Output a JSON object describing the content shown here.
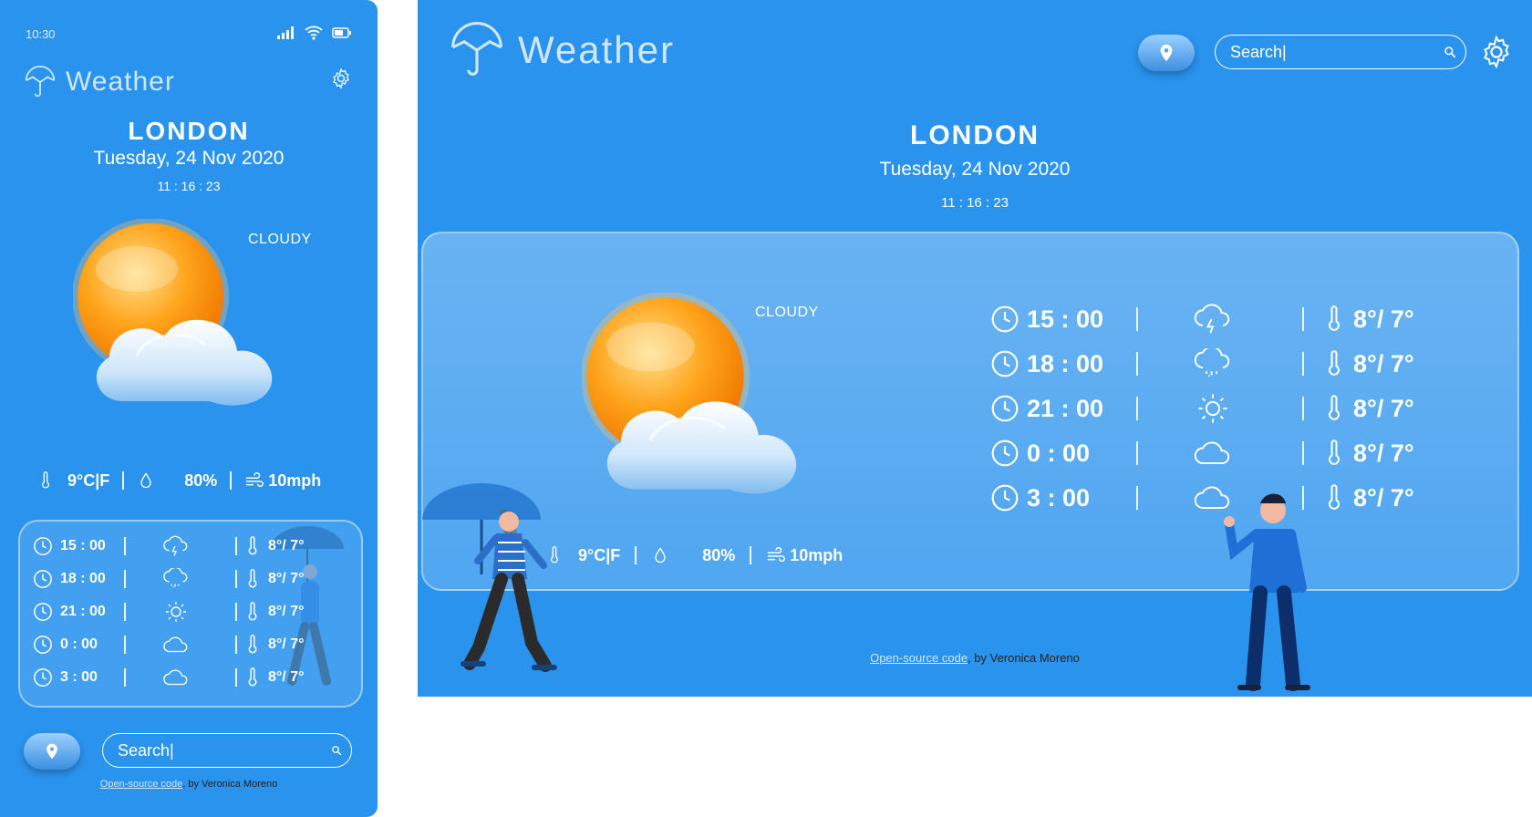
{
  "mobile": {
    "status_time": "10:30",
    "app_title": "Weather",
    "city": "LONDON",
    "date": "Tuesday, 24 Nov 2020",
    "clock": "11 : 16 : 23",
    "condition": "CLOUDY",
    "stats": {
      "temp": "9°C|F",
      "humidity": "80%",
      "wind": "10mph"
    },
    "forecast": [
      {
        "time": "15 : 00",
        "icon": "thunder-cloud-icon",
        "temps": "8°/ 7°"
      },
      {
        "time": "18 : 00",
        "icon": "rain-cloud-icon",
        "temps": "8°/ 7°"
      },
      {
        "time": "21 : 00",
        "icon": "sun-icon",
        "temps": "8°/ 7°"
      },
      {
        "time": "0 : 00",
        "icon": "cloud-icon",
        "temps": "8°/ 7°"
      },
      {
        "time": "3 : 00",
        "icon": "cloud-icon",
        "temps": "8°/ 7°"
      }
    ],
    "search_placeholder": "Search|",
    "footer": {
      "link": "Open-source code",
      "text": ", by Veronica Moreno"
    }
  },
  "desktop": {
    "app_title": "Weather",
    "city": "LONDON",
    "date": "Tuesday, 24 Nov 2020",
    "clock": "11 : 16 : 23",
    "condition": "CLOUDY",
    "stats": {
      "temp": "9°C|F",
      "humidity": "80%",
      "wind": "10mph"
    },
    "forecast": [
      {
        "time": "15 : 00",
        "icon": "thunder-cloud-icon",
        "temps": "8°/ 7°"
      },
      {
        "time": "18 : 00",
        "icon": "rain-cloud-icon",
        "temps": "8°/ 7°"
      },
      {
        "time": "21 : 00",
        "icon": "sun-icon",
        "temps": "8°/ 7°"
      },
      {
        "time": "0 : 00",
        "icon": "cloud-icon",
        "temps": "8°/ 7°"
      },
      {
        "time": "3 : 00",
        "icon": "cloud-icon",
        "temps": "8°/ 7°"
      }
    ],
    "search_placeholder": "Search|",
    "footer": {
      "link": "Open-source code",
      "text": ", by Veronica Moreno"
    }
  },
  "colors": {
    "background": "#2a93ee",
    "text": "#ffffff",
    "footer_text": "#222222"
  }
}
